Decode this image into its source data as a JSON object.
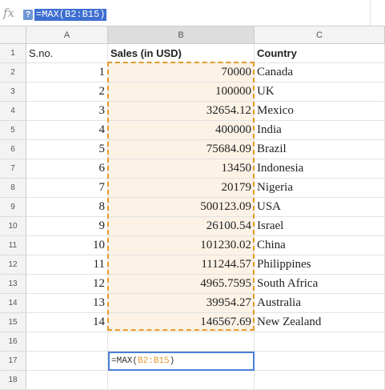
{
  "formula_bar": {
    "fx_label": "fx",
    "help_label": "?",
    "formula": "=MAX(B2:B15)"
  },
  "columns": [
    "A",
    "B",
    "C"
  ],
  "row_numbers": [
    "1",
    "2",
    "3",
    "4",
    "5",
    "6",
    "7",
    "8",
    "9",
    "10",
    "11",
    "12",
    "13",
    "14",
    "15",
    "16",
    "17",
    "18"
  ],
  "header": {
    "a": "S.no.",
    "b": "Sales (in USD)",
    "c": "Country"
  },
  "rows": [
    {
      "sno": "1",
      "sales": "70000",
      "country": "Canada"
    },
    {
      "sno": "2",
      "sales": "100000",
      "country": "UK"
    },
    {
      "sno": "3",
      "sales": "32654.12",
      "country": "Mexico"
    },
    {
      "sno": "4",
      "sales": "400000",
      "country": "India"
    },
    {
      "sno": "5",
      "sales": "75684.09",
      "country": "Brazil"
    },
    {
      "sno": "6",
      "sales": "13450",
      "country": "Indonesia"
    },
    {
      "sno": "7",
      "sales": "20179",
      "country": "Nigeria"
    },
    {
      "sno": "8",
      "sales": "500123.09",
      "country": "USA"
    },
    {
      "sno": "9",
      "sales": "26100.54",
      "country": "Israel"
    },
    {
      "sno": "10",
      "sales": "101230.02",
      "country": "China"
    },
    {
      "sno": "11",
      "sales": "111244.57",
      "country": "Philippines"
    },
    {
      "sno": "12",
      "sales": "4965.7595",
      "country": "South Africa"
    },
    {
      "sno": "13",
      "sales": "39954.27",
      "country": "Australia"
    },
    {
      "sno": "14",
      "sales": "146567.69",
      "country": "New Zealand"
    }
  ],
  "active_cell": {
    "prefix": "=MAX(",
    "range": "B2:B15",
    "suffix": ")"
  },
  "colors": {
    "range_highlight": "#e59a2b",
    "range_fill": "#fcf2e6",
    "active_border": "#4a7fd6",
    "formula_selection": "#3e6fd0"
  }
}
